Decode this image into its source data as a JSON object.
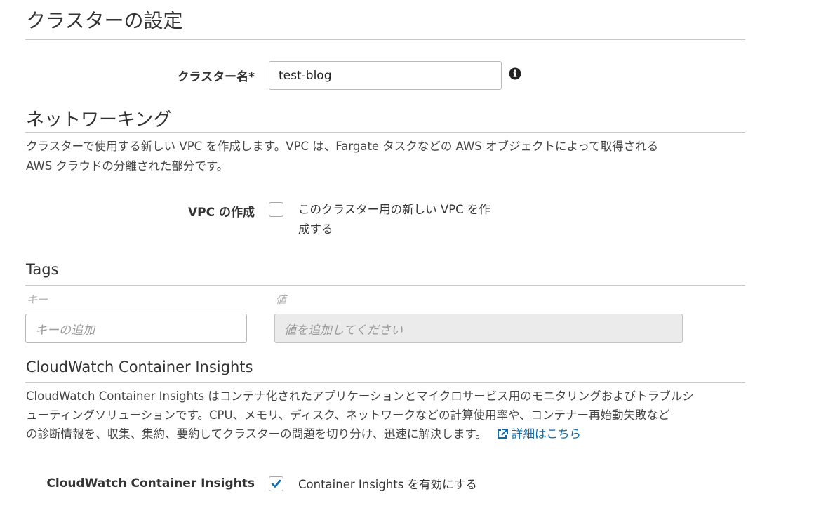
{
  "cluster_settings": {
    "title": "クラスターの設定",
    "name_label": "クラスター名*",
    "name_value": "test-blog",
    "info_icon": "info-circle-icon"
  },
  "networking": {
    "title": "ネットワーキング",
    "description_line1": "クラスターで使用する新しい VPC を作成します。VPC は、Fargate タスクなどの AWS オブジェクトによって取得される",
    "description_line2": "AWS クラウドの分離された部分です。",
    "vpc_label": "VPC の作成",
    "vpc_checkbox_checked": false,
    "vpc_option_line1": "このクラスター用の新しい VPC を作",
    "vpc_option_line2": "成する"
  },
  "tags": {
    "title": "Tags",
    "key_header": "キー",
    "value_header": "値",
    "key_placeholder": "キーの追加",
    "value_placeholder": "値を追加してください"
  },
  "container_insights": {
    "title": "CloudWatch Container Insights",
    "description_line1": "CloudWatch Container Insights はコンテナ化されたアプリケーションとマイクロサービス用のモニタリングおよびトラブルシ",
    "description_line2": "ューティングソリューションです。CPU、メモリ、ディスク、ネットワークなどの計算使用率や、コンテナー再始動失敗など",
    "description_line3": "の診断情報を、収集、集約、要約してクラスターの問題を切り分け、迅速に解決します。",
    "link_icon": "external-link-icon",
    "link_text": "詳細はこちら",
    "field_label": "CloudWatch Container Insights",
    "checkbox_checked": true,
    "checkbox_text": "Container Insights を有効にする",
    "accent_color": "#0a6db0"
  }
}
